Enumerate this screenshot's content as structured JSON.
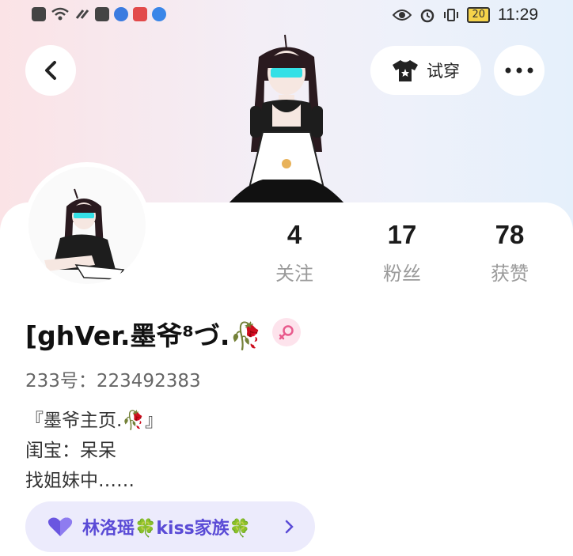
{
  "status_bar": {
    "time": "11:29",
    "battery": "20"
  },
  "header": {
    "tryon_label": "试穿"
  },
  "stats": [
    {
      "value": "4",
      "label": "关注"
    },
    {
      "value": "17",
      "label": "粉丝"
    },
    {
      "value": "78",
      "label": "获赞"
    }
  ],
  "profile": {
    "nickname": "[ghVer.墨爷⁸づ.🥀",
    "uid_text": "233号：223492383",
    "bio_lines": [
      "『墨爷主页.🥀』",
      "闺宝：呆呆",
      "找姐妹中……"
    ]
  },
  "family": {
    "label": "林洛瑶🍀kiss家族🍀"
  },
  "colors": {
    "accent": "#5a4bd6",
    "pill_bg": "#ecebfc",
    "gender": "#e85a8c"
  }
}
